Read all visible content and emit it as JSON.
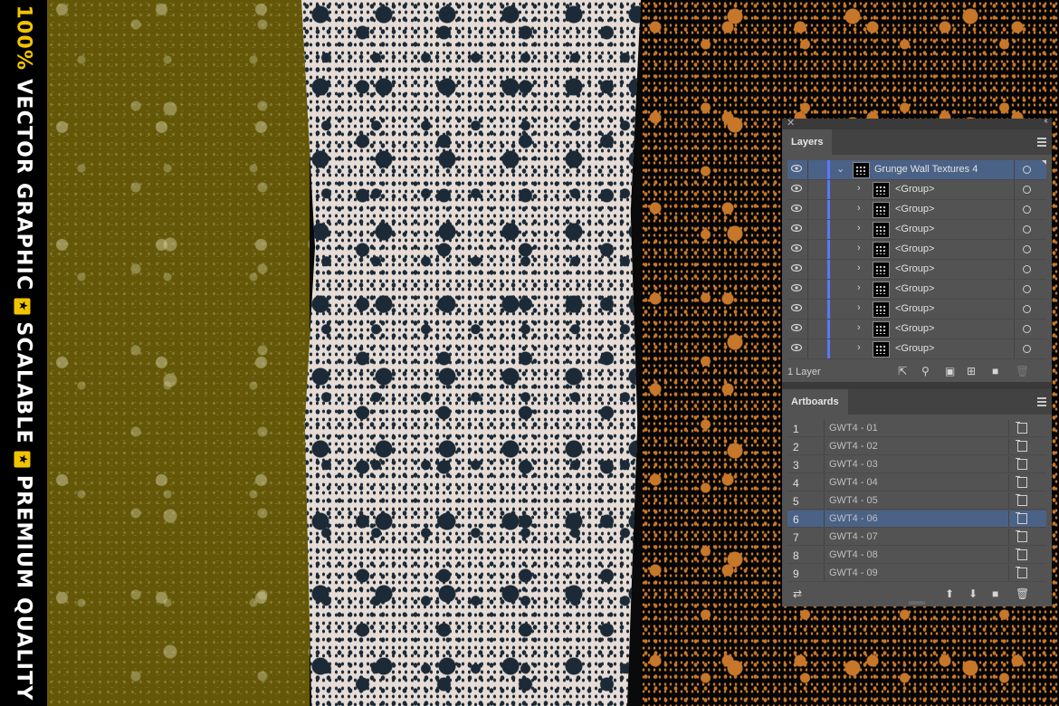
{
  "banner": {
    "prefix": "100%",
    "part1": " VECTOR GRAPHIC",
    "part2": "SCALABLE",
    "part3": "PREMIUM QUALITY",
    "star_icon": "star-badge-icon",
    "colors": {
      "accent": "#f2c400",
      "text": "#ffffff",
      "background": "#000000"
    }
  },
  "textures": {
    "colors": {
      "olive": "#645808",
      "olive_speckle": "#c8c396",
      "cream": "#e6dcd5",
      "navy_speckle": "#1b2a36",
      "dark": "#050505",
      "orange_speckle": "#c7772a"
    }
  },
  "layers_panel": {
    "tab_label": "Layers",
    "main_layer": {
      "name": "Grunge Wall Textures 4",
      "expanded": true,
      "selected": true
    },
    "groups": [
      {
        "name": "<Group>"
      },
      {
        "name": "<Group>"
      },
      {
        "name": "<Group>"
      },
      {
        "name": "<Group>"
      },
      {
        "name": "<Group>"
      },
      {
        "name": "<Group>"
      },
      {
        "name": "<Group>"
      },
      {
        "name": "<Group>"
      },
      {
        "name": "<Group>"
      }
    ],
    "footer_count": "1 Layer",
    "footer_icons": [
      "export-icon",
      "search-icon",
      "clipping-mask-icon",
      "new-sublayer-icon",
      "new-layer-icon",
      "trash-icon"
    ],
    "colors": {
      "panel_bg": "#535353",
      "selected_row": "#4b6287",
      "layer_color_bar": "#5978ff"
    }
  },
  "artboards_panel": {
    "tab_label": "Artboards",
    "rows": [
      {
        "num": "1",
        "name": "GWT4 - 01"
      },
      {
        "num": "2",
        "name": "GWT4 - 02"
      },
      {
        "num": "3",
        "name": "GWT4 - 03"
      },
      {
        "num": "4",
        "name": "GWT4 - 04"
      },
      {
        "num": "5",
        "name": "GWT4 - 05"
      },
      {
        "num": "6",
        "name": "GWT4 - 06",
        "selected": true
      },
      {
        "num": "7",
        "name": "GWT4 - 07"
      },
      {
        "num": "8",
        "name": "GWT4 - 08"
      },
      {
        "num": "9",
        "name": "GWT4 - 09"
      }
    ],
    "footer_icons": [
      "rearrange-icon",
      "move-up-icon",
      "move-down-icon",
      "new-artboard-icon",
      "trash-icon"
    ]
  }
}
